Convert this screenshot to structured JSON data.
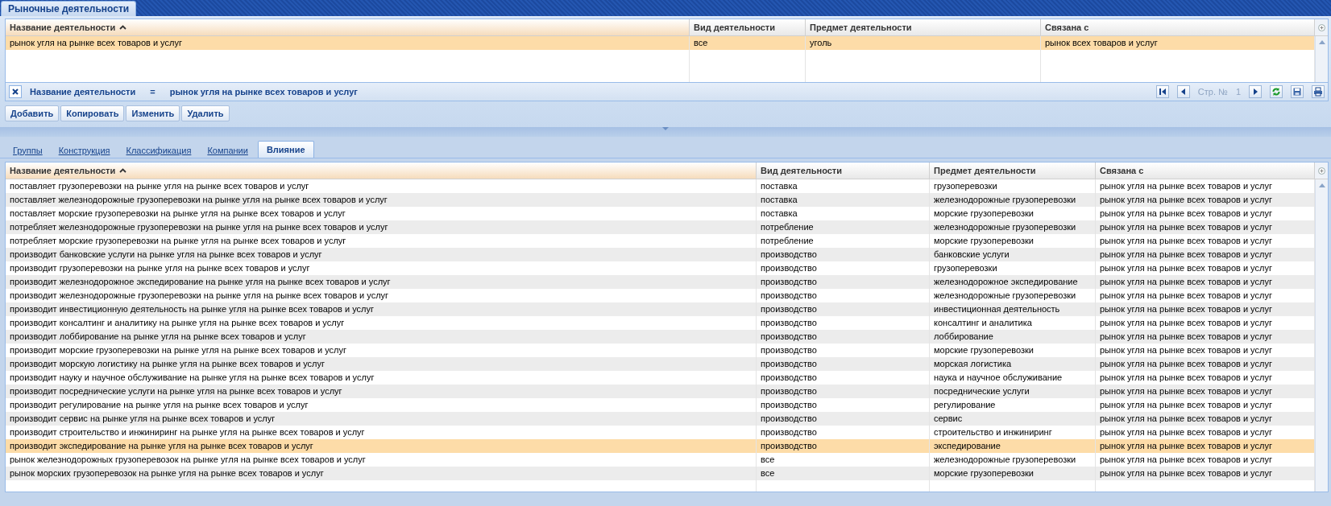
{
  "window_tabs": [
    {
      "label": "Рыночные деятельности",
      "selected": true
    }
  ],
  "top_grid": {
    "columns": [
      {
        "label": "Название деятельности",
        "sorted": true
      },
      {
        "label": "Вид деятельности",
        "sorted": false
      },
      {
        "label": "Предмет деятельности",
        "sorted": false
      },
      {
        "label": "Связана с",
        "sorted": false
      }
    ],
    "rows": [
      {
        "cells": [
          "рынок угля на рынке всех товаров и услуг",
          "все",
          "уголь",
          "рынок всех товаров и услуг"
        ],
        "selected": true
      }
    ]
  },
  "filter": {
    "field": "Название деятельности",
    "operator": "=",
    "value": "рынок угля на рынке всех товаров и услуг"
  },
  "pager": {
    "page_label": "Стр. №",
    "page": "1"
  },
  "buttons": [
    "Добавить",
    "Копировать",
    "Изменить",
    "Удалить"
  ],
  "tabs": [
    {
      "label": "Группы",
      "selected": false
    },
    {
      "label": "Конструкция",
      "selected": false
    },
    {
      "label": "Классификация",
      "selected": false
    },
    {
      "label": "Компании",
      "selected": false
    },
    {
      "label": "Влияние",
      "selected": true
    }
  ],
  "bottom_grid": {
    "columns": [
      {
        "label": "Название деятельности",
        "sorted": true
      },
      {
        "label": "Вид деятельности",
        "sorted": false
      },
      {
        "label": "Предмет деятельности",
        "sorted": false
      },
      {
        "label": "Связана с",
        "sorted": false
      }
    ],
    "rows": [
      {
        "cells": [
          "поставляет грузоперевозки на рынке угля на рынке всех товаров и услуг",
          "поставка",
          "грузоперевозки",
          "рынок угля на рынке всех товаров и услуг"
        ],
        "selected": false
      },
      {
        "cells": [
          "поставляет железнодорожные грузоперевозки на рынке угля на рынке всех товаров и услуг",
          "поставка",
          "железнодорожные грузоперевозки",
          "рынок угля на рынке всех товаров и услуг"
        ],
        "selected": false
      },
      {
        "cells": [
          "поставляет морские грузоперевозки на рынке угля на рынке всех товаров и услуг",
          "поставка",
          "морские грузоперевозки",
          "рынок угля на рынке всех товаров и услуг"
        ],
        "selected": false
      },
      {
        "cells": [
          "потребляет железнодорожные грузоперевозки на рынке угля на рынке всех товаров и услуг",
          "потребление",
          "железнодорожные грузоперевозки",
          "рынок угля на рынке всех товаров и услуг"
        ],
        "selected": false
      },
      {
        "cells": [
          "потребляет морские грузоперевозки на рынке угля на рынке всех товаров и услуг",
          "потребление",
          "морские грузоперевозки",
          "рынок угля на рынке всех товаров и услуг"
        ],
        "selected": false
      },
      {
        "cells": [
          "производит банковские услуги на рынке угля на рынке всех товаров и услуг",
          "производство",
          "банковские услуги",
          "рынок угля на рынке всех товаров и услуг"
        ],
        "selected": false
      },
      {
        "cells": [
          "производит грузоперевозки на рынке угля на рынке всех товаров и услуг",
          "производство",
          "грузоперевозки",
          "рынок угля на рынке всех товаров и услуг"
        ],
        "selected": false
      },
      {
        "cells": [
          "производит железнодорожное экспедирование на рынке угля на рынке всех товаров и услуг",
          "производство",
          "железнодорожное экспедирование",
          "рынок угля на рынке всех товаров и услуг"
        ],
        "selected": false
      },
      {
        "cells": [
          "производит железнодорожные грузоперевозки на рынке угля на рынке всех товаров и услуг",
          "производство",
          "железнодорожные грузоперевозки",
          "рынок угля на рынке всех товаров и услуг"
        ],
        "selected": false
      },
      {
        "cells": [
          "производит инвестиционную деятельность на рынке угля на рынке всех товаров и услуг",
          "производство",
          "инвестиционная деятельность",
          "рынок угля на рынке всех товаров и услуг"
        ],
        "selected": false
      },
      {
        "cells": [
          "производит консалтинг и аналитику на рынке угля на рынке всех товаров и услуг",
          "производство",
          "консалтинг и аналитика",
          "рынок угля на рынке всех товаров и услуг"
        ],
        "selected": false
      },
      {
        "cells": [
          "производит лоббирование на рынке угля на рынке всех товаров и услуг",
          "производство",
          "лоббирование",
          "рынок угля на рынке всех товаров и услуг"
        ],
        "selected": false
      },
      {
        "cells": [
          "производит морские грузоперевозки на рынке угля на рынке всех товаров и услуг",
          "производство",
          "морские грузоперевозки",
          "рынок угля на рынке всех товаров и услуг"
        ],
        "selected": false
      },
      {
        "cells": [
          "производит морскую логистику на рынке угля на рынке всех товаров и услуг",
          "производство",
          "морская логистика",
          "рынок угля на рынке всех товаров и услуг"
        ],
        "selected": false
      },
      {
        "cells": [
          "производит науку и научное обслуживание на рынке угля на рынке всех товаров и услуг",
          "производство",
          "наука и научное обслуживание",
          "рынок угля на рынке всех товаров и услуг"
        ],
        "selected": false
      },
      {
        "cells": [
          "производит посреднические услуги на рынке угля на рынке всех товаров и услуг",
          "производство",
          "посреднические услуги",
          "рынок угля на рынке всех товаров и услуг"
        ],
        "selected": false
      },
      {
        "cells": [
          "производит регулирование на рынке угля на рынке всех товаров и услуг",
          "производство",
          "регулирование",
          "рынок угля на рынке всех товаров и услуг"
        ],
        "selected": false
      },
      {
        "cells": [
          "производит сервис на рынке угля на рынке всех товаров и услуг",
          "производство",
          "сервис",
          "рынок угля на рынке всех товаров и услуг"
        ],
        "selected": false
      },
      {
        "cells": [
          "производит строительство и инжиниринг на рынке угля на рынке всех товаров и услуг",
          "производство",
          "строительство и инжиниринг",
          "рынок угля на рынке всех товаров и услуг"
        ],
        "selected": false
      },
      {
        "cells": [
          "производит экспедирование на рынке угля на рынке всех товаров и услуг",
          "производство",
          "экспедирование",
          "рынок угля на рынке всех товаров и услуг"
        ],
        "selected": true
      },
      {
        "cells": [
          "рынок железнодорожных грузоперевозок на рынке угля на рынке всех товаров и услуг",
          "все",
          "железнодорожные грузоперевозки",
          "рынок угля на рынке всех товаров и услуг"
        ],
        "selected": false
      },
      {
        "cells": [
          "рынок морских грузоперевозок на рынке угля на рынке всех товаров и услуг",
          "все",
          "морские грузоперевозки",
          "рынок угля на рынке всех товаров и услуг"
        ],
        "selected": false
      }
    ]
  }
}
